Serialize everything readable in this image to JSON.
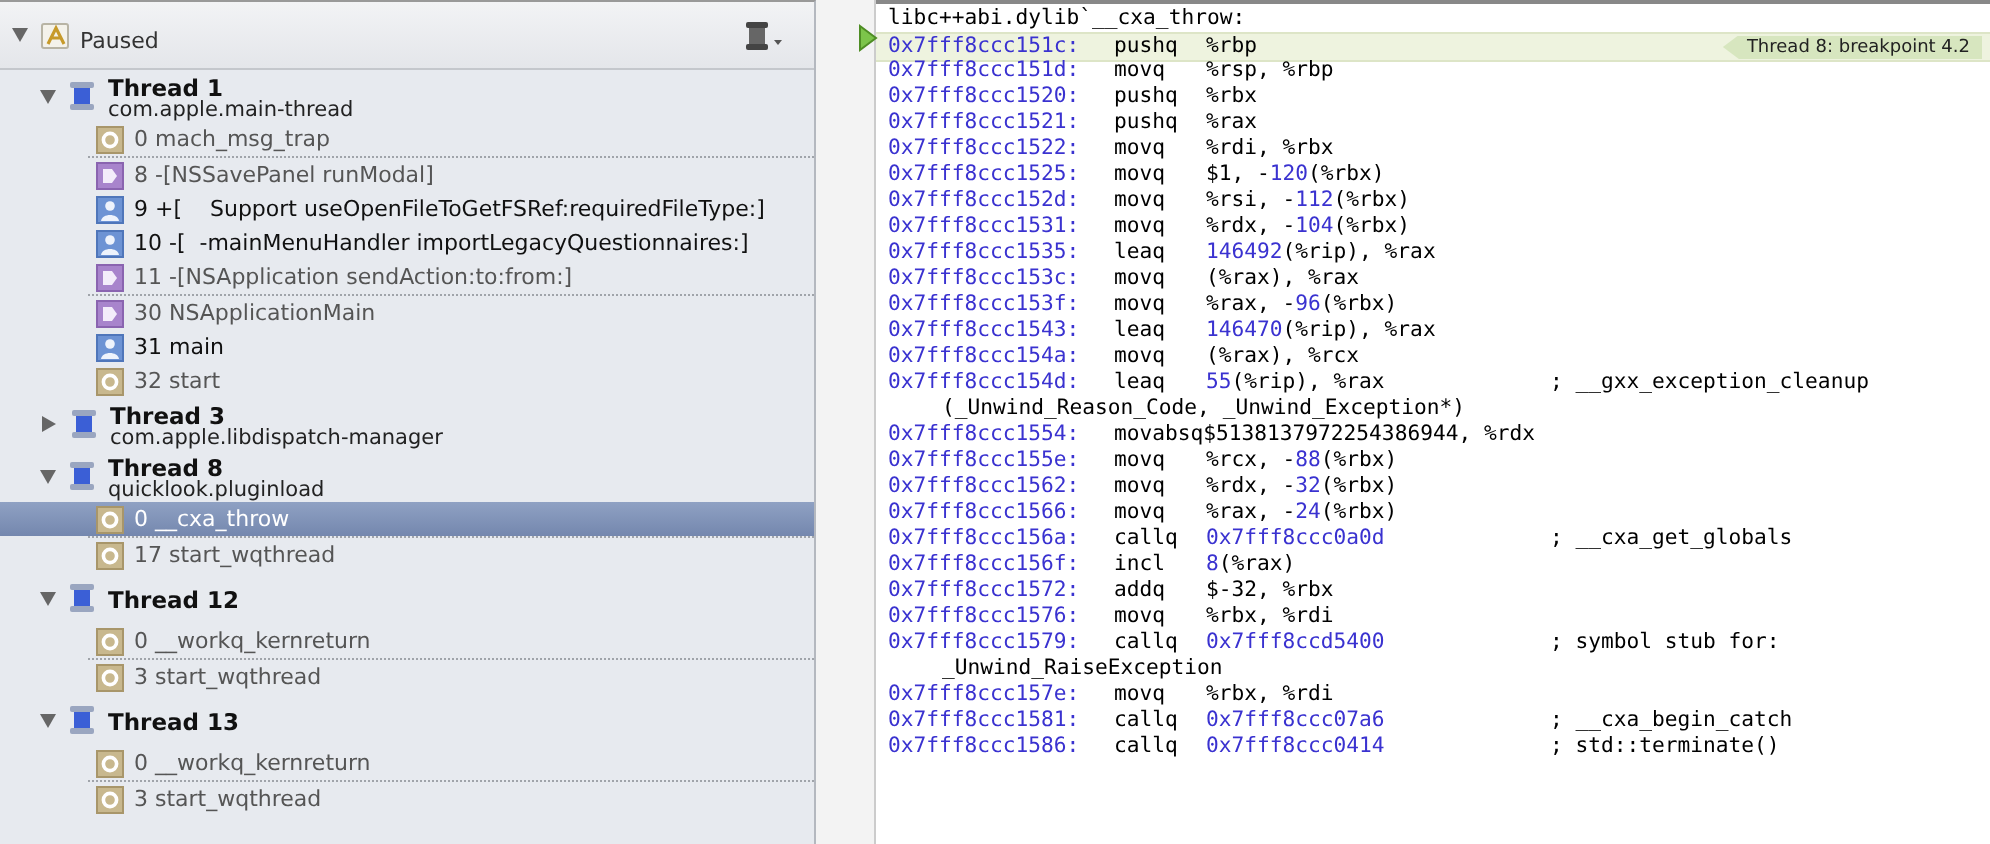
{
  "debug_navigator": {
    "status": "Paused",
    "threads": [
      {
        "name": "Thread 1",
        "queue": "com.apple.main-thread",
        "expanded": true,
        "frames": [
          {
            "kind": "system",
            "label": "0 mach_msg_trap",
            "selected": false,
            "gap_before": false
          },
          {
            "kind": "framework",
            "label": "8 -[NSSavePanel runModal]",
            "selected": false,
            "gap_before": true
          },
          {
            "kind": "user",
            "label": "9 +[    Support useOpenFileToGetFSRef:requiredFileType:]",
            "selected": false,
            "gap_before": false
          },
          {
            "kind": "user",
            "label": "10 -[  -mainMenuHandler importLegacyQuestionnaires:]",
            "selected": false,
            "gap_before": false
          },
          {
            "kind": "framework",
            "label": "11 -[NSApplication sendAction:to:from:]",
            "selected": false,
            "gap_before": false
          },
          {
            "kind": "framework",
            "label": "30 NSApplicationMain",
            "selected": false,
            "gap_before": true
          },
          {
            "kind": "user",
            "label": "31 main",
            "selected": false,
            "gap_before": false
          },
          {
            "kind": "system",
            "label": "32 start",
            "selected": false,
            "gap_before": false
          }
        ]
      },
      {
        "name": "Thread 3",
        "queue": "com.apple.libdispatch-manager",
        "expanded": false
      },
      {
        "name": "Thread 8",
        "queue": "quicklook.pluginload",
        "expanded": true,
        "frames": [
          {
            "kind": "system",
            "label": "0 __cxa_throw",
            "selected": true,
            "gap_before": false
          },
          {
            "kind": "system",
            "label": "17 start_wqthread",
            "selected": false,
            "gap_before": true
          }
        ]
      },
      {
        "name": "Thread 12",
        "expanded": true,
        "frames": [
          {
            "kind": "system",
            "label": "0 __workq_kernreturn",
            "selected": false,
            "gap_before": false
          },
          {
            "kind": "system",
            "label": "3 start_wqthread",
            "selected": false,
            "gap_before": true
          }
        ]
      },
      {
        "name": "Thread 13",
        "expanded": true,
        "frames": [
          {
            "kind": "system",
            "label": "0 __workq_kernreturn",
            "selected": false,
            "gap_before": false
          },
          {
            "kind": "system",
            "label": "3 start_wqthread",
            "selected": false,
            "gap_before": true
          }
        ]
      }
    ]
  },
  "disassembly": {
    "header": "libc++abi.dylib`__cxa_throw:",
    "breakpoint_label": "Thread 8: breakpoint 4.2",
    "lines": [
      {
        "address": "0x7fff8ccc151c:",
        "op": "pushq",
        "args": "%rbp",
        "current": true
      },
      {
        "address": "0x7fff8ccc151d:",
        "op": "movq",
        "args": "%rsp, %rbp",
        "current": false
      },
      {
        "address": "0x7fff8ccc1520:",
        "op": "pushq",
        "args": "%rbx",
        "current": false
      },
      {
        "address": "0x7fff8ccc1521:",
        "op": "pushq",
        "args": "%rax",
        "current": false
      },
      {
        "address": "0x7fff8ccc1522:",
        "op": "movq",
        "args": "%rdi, %rbx",
        "current": false
      },
      {
        "address": "0x7fff8ccc1525:",
        "op": "movq",
        "args": "$1, -120(%rbx)",
        "current": false
      },
      {
        "address": "0x7fff8ccc152d:",
        "op": "movq",
        "args": "%rsi, -112(%rbx)",
        "current": false
      },
      {
        "address": "0x7fff8ccc1531:",
        "op": "movq",
        "args": "%rdx, -104(%rbx)",
        "current": false
      },
      {
        "address": "0x7fff8ccc1535:",
        "op": "leaq",
        "args": "146492(%rip), %rax",
        "current": false
      },
      {
        "address": "0x7fff8ccc153c:",
        "op": "movq",
        "args": "(%rax), %rax",
        "current": false
      },
      {
        "address": "0x7fff8ccc153f:",
        "op": "movq",
        "args": "%rax, -96(%rbx)",
        "current": false
      },
      {
        "address": "0x7fff8ccc1543:",
        "op": "leaq",
        "args": "146470(%rip), %rax",
        "current": false
      },
      {
        "address": "0x7fff8ccc154a:",
        "op": "movq",
        "args": "(%rax), %rcx",
        "current": false
      },
      {
        "address": "0x7fff8ccc154d:",
        "op": "leaq",
        "args": "55(%rip), %rax",
        "comment": "; __gxx_exception_cleanup",
        "continuation": "(_Unwind_Reason_Code, _Unwind_Exception*)",
        "current": false
      },
      {
        "address": "0x7fff8ccc1554:",
        "op": "movabsq$5138137972254386944, %rdx",
        "current": false
      },
      {
        "address": "0x7fff8ccc155e:",
        "op": "movq",
        "args": "%rcx, -88(%rbx)",
        "current": false
      },
      {
        "address": "0x7fff8ccc1562:",
        "op": "movq",
        "args": "%rdx, -32(%rbx)",
        "current": false
      },
      {
        "address": "0x7fff8ccc1566:",
        "op": "movq",
        "args": "%rax, -24(%rbx)",
        "current": false
      },
      {
        "address": "0x7fff8ccc156a:",
        "op": "callq",
        "args": "0x7fff8ccc0a0d",
        "comment": "; __cxa_get_globals",
        "current": false
      },
      {
        "address": "0x7fff8ccc156f:",
        "op": "incl",
        "args": "8(%rax)",
        "current": false
      },
      {
        "address": "0x7fff8ccc1572:",
        "op": "addq",
        "args": "$-32, %rbx",
        "current": false
      },
      {
        "address": "0x7fff8ccc1576:",
        "op": "movq",
        "args": "%rbx, %rdi",
        "current": false
      },
      {
        "address": "0x7fff8ccc1579:",
        "op": "callq",
        "args": "0x7fff8ccd5400",
        "comment": "; symbol stub for:",
        "continuation": "_Unwind_RaiseException",
        "current": false
      },
      {
        "address": "0x7fff8ccc157e:",
        "op": "movq",
        "args": "%rbx, %rdi",
        "current": false
      },
      {
        "address": "0x7fff8ccc1581:",
        "op": "callq",
        "args": "0x7fff8ccc07a6",
        "comment": "; __cxa_begin_catch",
        "current": false
      },
      {
        "address": "0x7fff8ccc1586:",
        "op": "callq",
        "args": "0x7fff8ccc0414",
        "comment": "; std::terminate()",
        "current": false
      }
    ]
  }
}
